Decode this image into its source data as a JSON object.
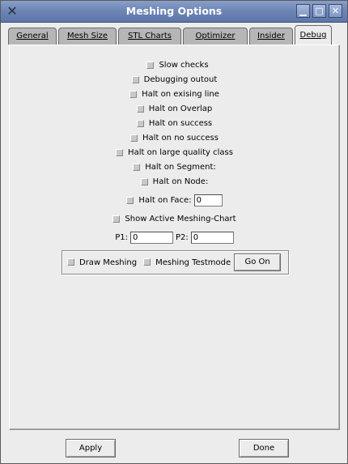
{
  "window": {
    "title": "Meshing Options"
  },
  "tabs": [
    "General",
    "Mesh Size",
    "STL Charts",
    "Optimizer",
    "Insider",
    "Debug"
  ],
  "debug": {
    "checks": [
      "Slow checks",
      "Debugging outout",
      "Halt on exising line",
      "Halt on Overlap",
      "Halt on success",
      "Halt on no success",
      "Halt on large quality class",
      "Halt on Segment:",
      "Halt on Node:"
    ],
    "face_label": "Halt on Face:",
    "face_value": "0",
    "show_chart": "Show Active Meshing-Chart",
    "p1_label": "P1:",
    "p1_value": "0",
    "p2_label": "P2:",
    "p2_value": "0",
    "draw_meshing": "Draw Meshing",
    "meshing_testmode": "Meshing Testmode",
    "go_on": "Go On"
  },
  "buttons": {
    "apply": "Apply",
    "done": "Done"
  }
}
